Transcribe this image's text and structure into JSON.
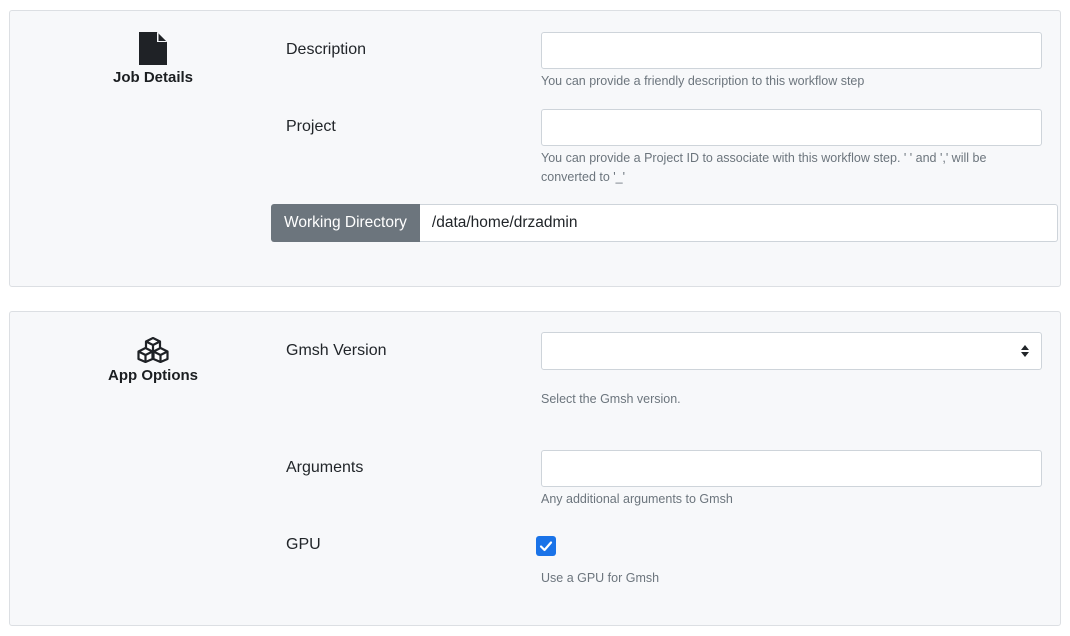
{
  "job_details": {
    "title": "Job Details",
    "icon": "file-icon",
    "description": {
      "label": "Description",
      "value": "",
      "help": "You can provide a friendly description to this workflow step"
    },
    "project": {
      "label": "Project",
      "value": "",
      "help": "You can provide a Project ID to associate with this workflow step. ' ' and ',' will be converted to '_'"
    },
    "working_directory": {
      "label": "Working Directory",
      "value": "/data/home/drzadmin"
    }
  },
  "app_options": {
    "title": "App Options",
    "icon": "cubes-icon",
    "gmsh_version": {
      "label": "Gmsh Version",
      "selected": "",
      "help": "Select the Gmsh version."
    },
    "arguments": {
      "label": "Arguments",
      "value": "",
      "help": "Any additional arguments to Gmsh"
    },
    "gpu": {
      "label": "GPU",
      "checked": true,
      "help": "Use a GPU for Gmsh"
    }
  },
  "colors": {
    "panel_bg": "#f7f8fa",
    "addon_bg": "#6c757d",
    "checkbox_blue": "#1a73e8",
    "help_text": "#6c757d"
  }
}
